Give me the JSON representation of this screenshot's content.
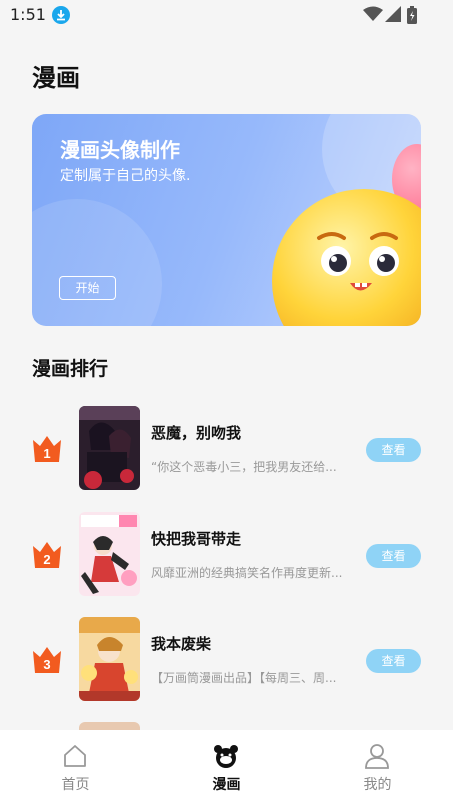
{
  "status_bar": {
    "time": "1:51"
  },
  "page": {
    "title": "漫画"
  },
  "banner": {
    "title": "漫画头像制作",
    "subtitle": "定制属于自己的头像.",
    "button_label": "开始"
  },
  "ranking": {
    "title": "漫画排行",
    "items": [
      {
        "rank": "1",
        "title": "恶魔，别吻我",
        "desc": "“你这个恶毒小三，把我男友还给...",
        "button": "查看"
      },
      {
        "rank": "2",
        "title": "快把我哥带走",
        "desc": "风靡亚洲的经典搞笑名作再度更新...",
        "button": "查看"
      },
      {
        "rank": "3",
        "title": "我本废柴",
        "desc": "【万画筒漫画出品】【每周三、周...",
        "button": "查看"
      }
    ]
  },
  "tab_bar": {
    "tabs": [
      {
        "label": "首页",
        "icon": "home-icon"
      },
      {
        "label": "漫画",
        "icon": "bear-icon"
      },
      {
        "label": "我的",
        "icon": "user-icon"
      }
    ]
  },
  "colors": {
    "accent": "#8fd3f6",
    "crown": "#f25b1f",
    "banner": "#8db2fa"
  }
}
